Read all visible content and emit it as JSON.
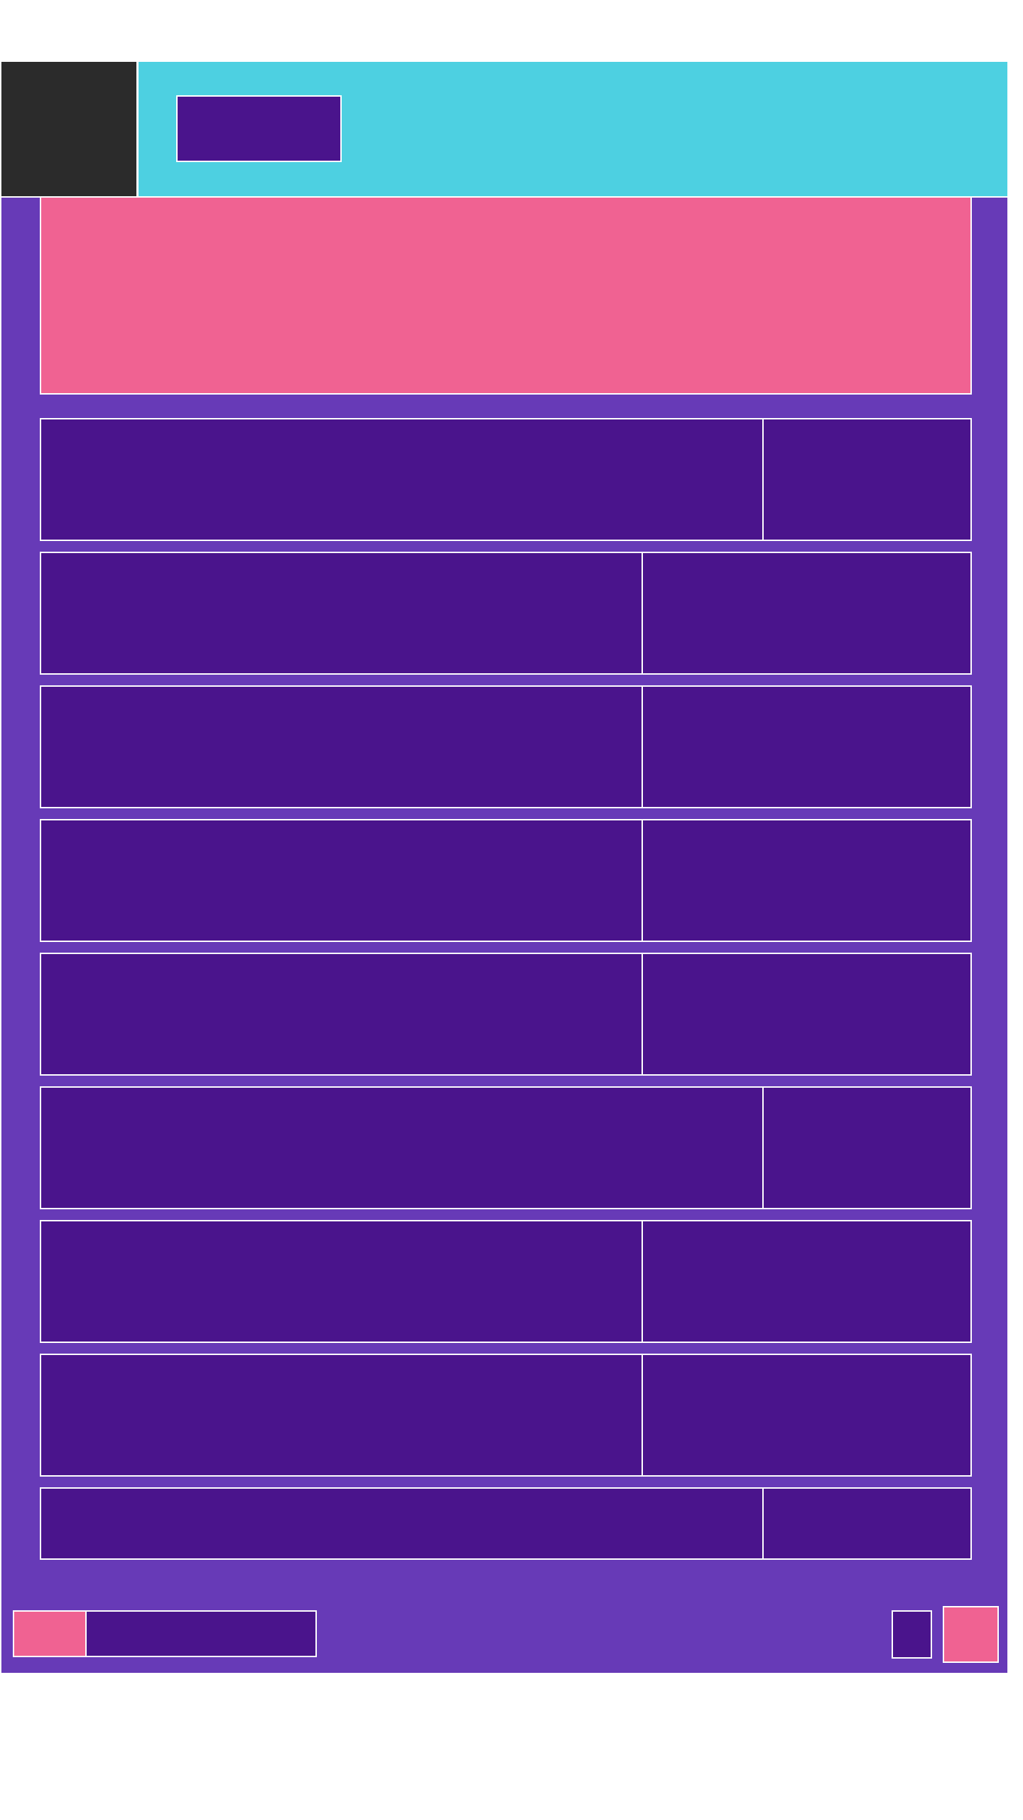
{
  "colors": {
    "page_background": "#ffffff",
    "app_background": "#673ab7",
    "header_background": "#4dd0e1",
    "menu_panel": "#2b2b2b",
    "tile_dark": "#4a148c",
    "accent_pink": "#f06292",
    "border": "#ffffff"
  },
  "header": {
    "menu_icon": "menu-icon",
    "title": ""
  },
  "hero": {
    "text": ""
  },
  "list": {
    "rows": [
      {
        "label": "",
        "value": "",
        "layout": "wide"
      },
      {
        "label": "",
        "value": "",
        "layout": "narrow"
      },
      {
        "label": "",
        "value": "",
        "layout": "narrow"
      },
      {
        "label": "",
        "value": "",
        "layout": "narrow"
      },
      {
        "label": "",
        "value": "",
        "layout": "narrow"
      },
      {
        "label": "",
        "value": "",
        "layout": "wide"
      },
      {
        "label": "",
        "value": "",
        "layout": "narrow"
      },
      {
        "label": "",
        "value": "",
        "layout": "narrow"
      },
      {
        "label": "",
        "value": "",
        "layout": "wide"
      }
    ]
  },
  "footer": {
    "chip_label": "",
    "nav_text": "",
    "small_button_label": "",
    "fab_label": ""
  }
}
